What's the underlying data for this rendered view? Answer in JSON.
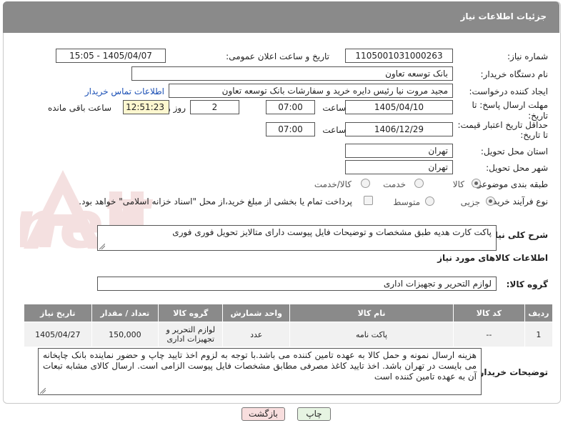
{
  "header": {
    "title": "جزئیات اطلاعات نیاز"
  },
  "fields": {
    "need_number_label": "شماره نیاز:",
    "need_number": "1105001031000263",
    "announce_label": "تاریخ و ساعت اعلان عمومی:",
    "announce_value": "1405/04/07 - 15:05",
    "buyer_org_label": "نام دستگاه خریدار:",
    "buyer_org": "بانک توسعه تعاون",
    "creator_label": "ایجاد کننده درخواست:",
    "creator": "مجید مروت نیا رئیس دایره خرید و سفارشات بانک توسعه تعاون",
    "contact_link": "اطلاعات تماس خریدار",
    "deadline_label_1": "مهلت ارسال پاسخ: تا",
    "deadline_label_2": "تاریخ:",
    "deadline_date": "1405/04/10",
    "time_label": "ساعت",
    "deadline_time": "07:00",
    "days_value": "2",
    "days_label": "روز و",
    "remaining_time": "12:51:23",
    "remaining_label": "ساعت باقی مانده",
    "validity_label_1": "حداقل تاریخ اعتبار قیمت:",
    "validity_label_2": "تا تاریخ:",
    "validity_date": "1406/12/29",
    "validity_time_label": "ساعت",
    "validity_time": "07:00",
    "province_label": "استان محل تحویل:",
    "province": "تهران",
    "city_label": "شهر محل تحویل:",
    "city": "تهران",
    "category_label": "طبقه بندی موضوعی:",
    "category_options": [
      "کالا",
      "خدمت",
      "کالا/خدمت"
    ],
    "process_label": "نوع فرآیند خرید :",
    "process_options": [
      "جزیی",
      "متوسط"
    ],
    "payment_note": "پرداخت تمام یا بخشی از مبلغ خرید،از محل \"اسناد خزانه اسلامی\" خواهد بود."
  },
  "summary": {
    "label": "شرح کلی نیاز:",
    "text": "پاکت کارت هدیه طبق مشخصات و توضیحات فایل پیوست دارای متالایز تحویل فوری فوری"
  },
  "goods": {
    "section_title": "اطلاعات کالاهای مورد نیاز",
    "group_label": "گروه کالا:",
    "group_value": "لوازم التحریر و تجهیزات اداری"
  },
  "table": {
    "headers": [
      "ردیف",
      "کد کالا",
      "نام کالا",
      "واحد شمارش",
      "گروه کالا",
      "تعداد / مقدار",
      "تاریخ نیاز"
    ],
    "rows": [
      [
        "1",
        "--",
        "پاکت نامه",
        "عدد",
        "لوازم التحریر و تجهیزات اداری",
        "150,000",
        "1405/04/27"
      ]
    ]
  },
  "buyer_notes": {
    "label": "توضیحات خریدار:",
    "text": "هزینه ارسال نمونه و حمل کالا به عهده تامین کننده می باشد.با توجه به لزوم اخذ تایید چاپ و حضور نماینده بانک چاپخانه می بایست در تهران باشد. اخذ تایید کاغذ مصرفی مطابق مشخصات فایل پیوست الزامی است. ارسال کالای مشابه تبعات آن به عهده تامین کننده است"
  },
  "buttons": {
    "print": "چاپ",
    "back": "بازگشت"
  },
  "colors": {
    "header_bg": "#8a8a8a",
    "link": "#1a4fb5",
    "print_bg": "#e6f4e2",
    "back_bg": "#f8dede"
  }
}
